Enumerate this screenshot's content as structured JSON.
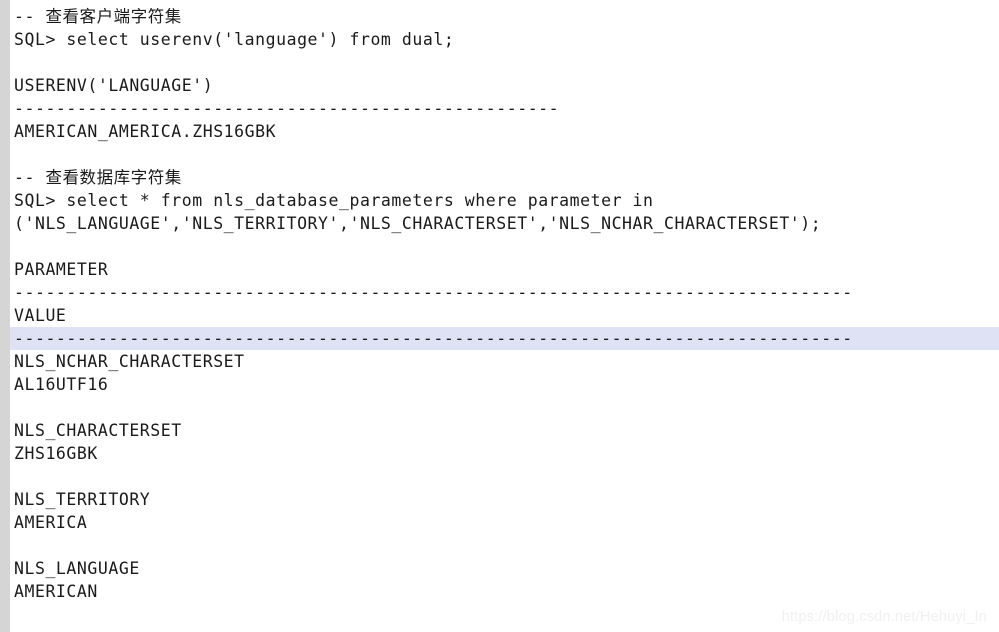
{
  "code_block": {
    "gutter_color": "#d5d5d5",
    "background_color": "#ffffff",
    "text_color": "#1a1a1a",
    "highlight_color": "#dfe2f5",
    "lines": [
      {
        "text": "-- 查看客户端字符集",
        "highlighted": false,
        "blank": false
      },
      {
        "text": "SQL> select userenv('language') from dual;",
        "highlighted": false,
        "blank": false
      },
      {
        "text": "",
        "highlighted": false,
        "blank": true
      },
      {
        "text": "USERENV('LANGUAGE')",
        "highlighted": false,
        "blank": false
      },
      {
        "text": "----------------------------------------------------",
        "highlighted": false,
        "blank": false
      },
      {
        "text": "AMERICAN_AMERICA.ZHS16GBK",
        "highlighted": false,
        "blank": false
      },
      {
        "text": "",
        "highlighted": false,
        "blank": true
      },
      {
        "text": "-- 查看数据库字符集",
        "highlighted": false,
        "blank": false
      },
      {
        "text": "SQL> select * from nls_database_parameters where parameter in",
        "highlighted": false,
        "blank": false
      },
      {
        "text": "('NLS_LANGUAGE','NLS_TERRITORY','NLS_CHARACTERSET','NLS_NCHAR_CHARACTERSET');",
        "highlighted": false,
        "blank": false
      },
      {
        "text": "",
        "highlighted": false,
        "blank": true
      },
      {
        "text": "PARAMETER",
        "highlighted": false,
        "blank": false
      },
      {
        "text": "--------------------------------------------------------------------------------",
        "highlighted": false,
        "blank": false
      },
      {
        "text": "VALUE",
        "highlighted": false,
        "blank": false
      },
      {
        "text": "--------------------------------------------------------------------------------",
        "highlighted": true,
        "blank": false
      },
      {
        "text": "NLS_NCHAR_CHARACTERSET",
        "highlighted": false,
        "blank": false
      },
      {
        "text": "AL16UTF16",
        "highlighted": false,
        "blank": false
      },
      {
        "text": "",
        "highlighted": false,
        "blank": true
      },
      {
        "text": "NLS_CHARACTERSET",
        "highlighted": false,
        "blank": false
      },
      {
        "text": "ZHS16GBK",
        "highlighted": false,
        "blank": false
      },
      {
        "text": "",
        "highlighted": false,
        "blank": true
      },
      {
        "text": "NLS_TERRITORY",
        "highlighted": false,
        "blank": false
      },
      {
        "text": "AMERICA",
        "highlighted": false,
        "blank": false
      },
      {
        "text": "",
        "highlighted": false,
        "blank": true
      },
      {
        "text": "NLS_LANGUAGE",
        "highlighted": false,
        "blank": false
      },
      {
        "text": "AMERICAN",
        "highlighted": false,
        "blank": false
      }
    ]
  },
  "watermark": {
    "text": "https://blog.csdn.net/Hehuyi_In"
  }
}
